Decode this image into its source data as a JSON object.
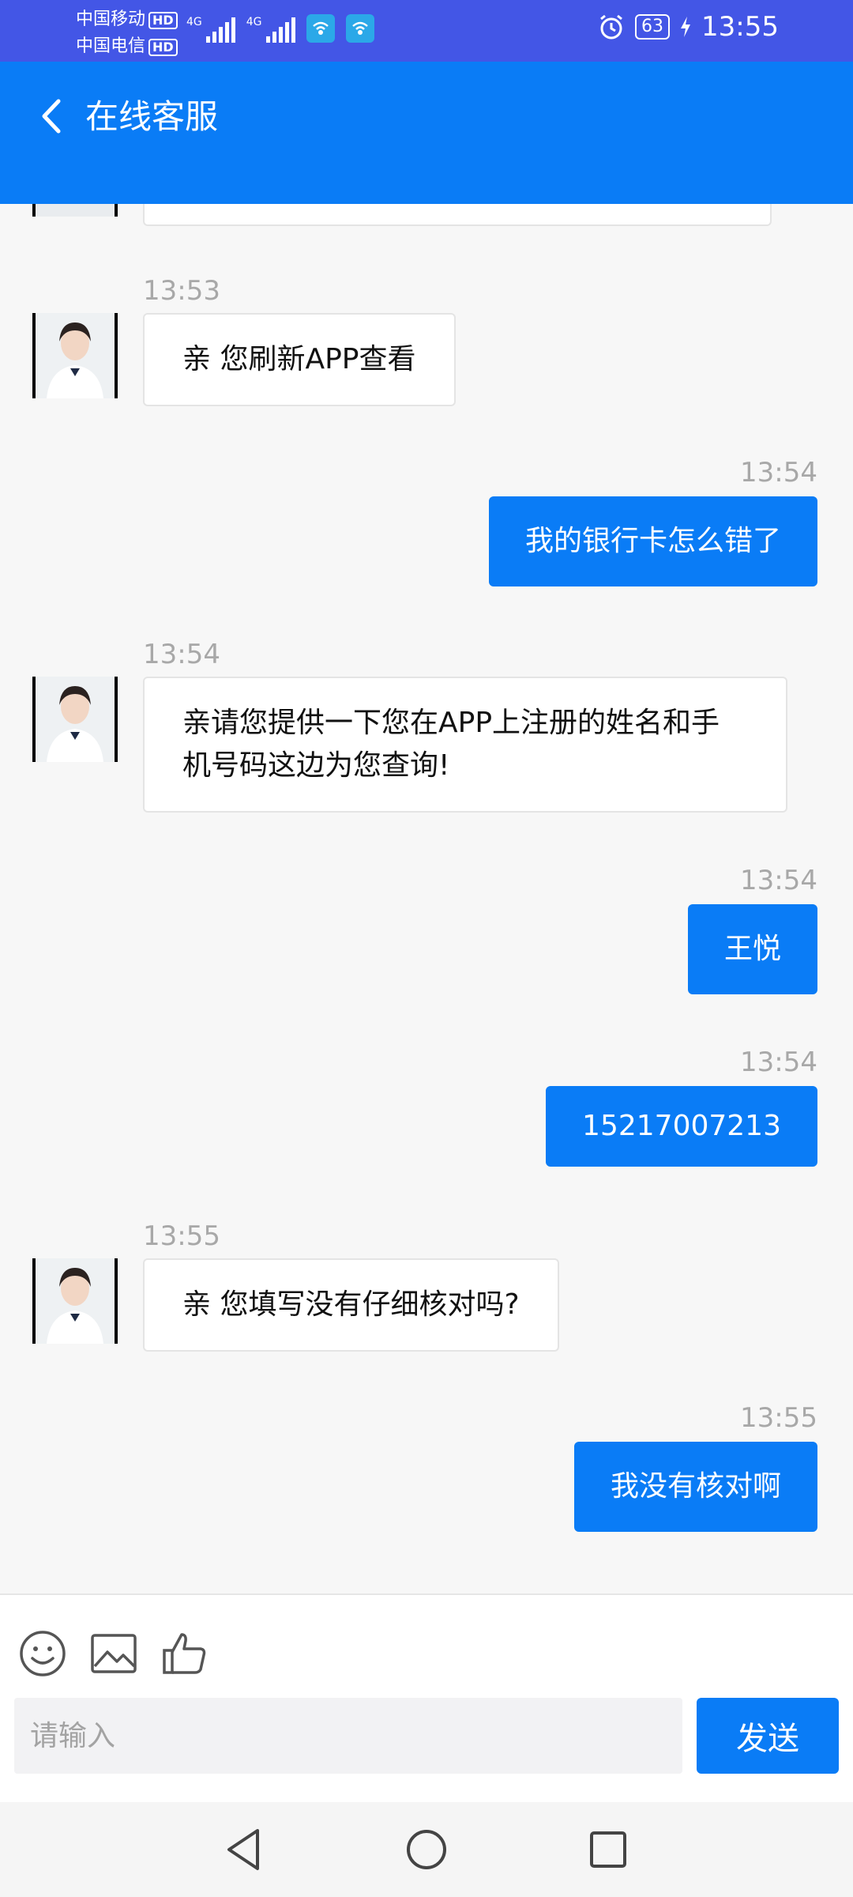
{
  "status_bar": {
    "carrier_1": "中国移动",
    "carrier_2": "中国电信",
    "hd_label": "HD",
    "network_1": "4G",
    "network_2": "4G",
    "battery": "63",
    "time": "13:55",
    "icons": [
      "signal-icon",
      "wifi-hotspot-icon",
      "alarm-icon",
      "battery-icon",
      "charging-icon"
    ]
  },
  "header": {
    "title": "在线客服",
    "back_icon": "chevron-left-icon",
    "background": "#0a7cf6"
  },
  "messages": [
    {
      "side": "in",
      "time": "13:53",
      "text": "亲 您刷新APP查看"
    },
    {
      "side": "out",
      "time": "13:54",
      "text": "我的银行卡怎么错了"
    },
    {
      "side": "in",
      "time": "13:54",
      "text": "亲请您提供一下您在APP上注册的姓名和手机号码这边为您查询!"
    },
    {
      "side": "out",
      "time": "13:54",
      "text": "王悦"
    },
    {
      "side": "out",
      "time": "13:54",
      "text": "15217007213"
    },
    {
      "side": "in",
      "time": "13:55",
      "text": "亲 您填写没有仔细核对吗?"
    },
    {
      "side": "out",
      "time": "13:55",
      "text": "我没有核对啊"
    }
  ],
  "composer": {
    "tools": [
      "emoji-icon",
      "image-icon",
      "thumbs-up-icon"
    ],
    "input_placeholder": "请输入",
    "input_value": "",
    "send_label": "发送",
    "accent": "#0a7cf6"
  },
  "nav_bar": {
    "icons": [
      "back-triangle-icon",
      "home-circle-icon",
      "recents-square-icon"
    ]
  }
}
